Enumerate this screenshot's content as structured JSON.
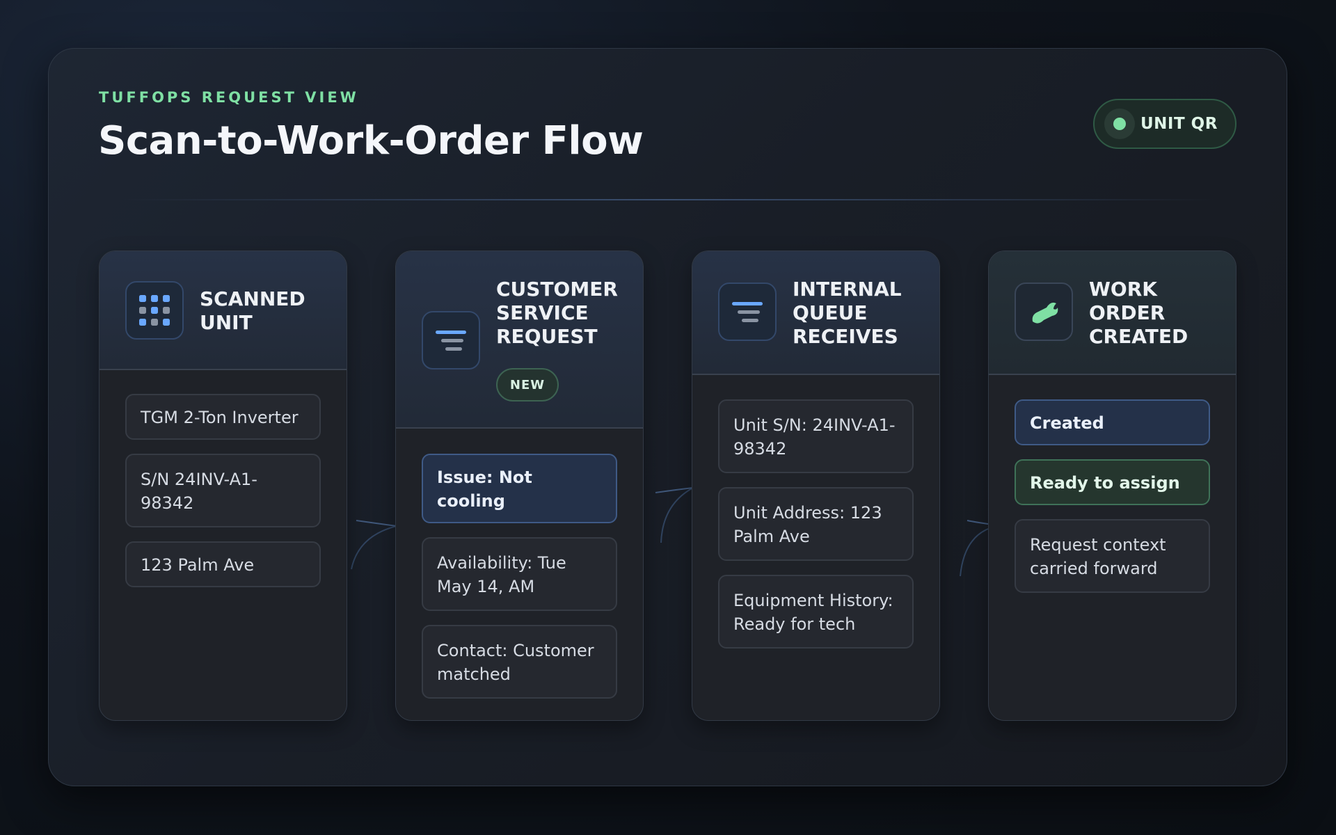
{
  "header": {
    "eyebrow": "TUFFOPS REQUEST VIEW",
    "title": "Scan-to-Work-Order Flow",
    "qr_label": "UNIT QR"
  },
  "colors": {
    "accent_green": "#7fe0a4",
    "accent_blue": "#6aa8ff",
    "background": "#0f141c"
  },
  "steps": [
    {
      "title": "SCANNED UNIT",
      "icon": "grid-icon",
      "badge": "",
      "items": [
        "TGM 2-Ton Inverter",
        "S/N 24INV-A1-98342",
        "123 Palm Ave"
      ]
    },
    {
      "title": "CUSTOMER SERVICE REQUEST",
      "icon": "lines-icon",
      "badge": "NEW",
      "items": [
        "Issue: Not cooling",
        "Availability: Tue May 14, AM",
        "Contact: Customer matched"
      ]
    },
    {
      "title": "INTERNAL QUEUE RECEIVES",
      "icon": "lines-icon",
      "badge": "",
      "items": [
        "Unit S/N: 24INV-A1-98342",
        "Unit Address: 123 Palm Ave",
        "Equipment History: Ready for tech"
      ]
    },
    {
      "title": "WORK ORDER CREATED",
      "icon": "wrench-icon",
      "badge": "",
      "items": [
        "Created",
        "Ready to assign",
        "Request context carried forward"
      ]
    }
  ]
}
